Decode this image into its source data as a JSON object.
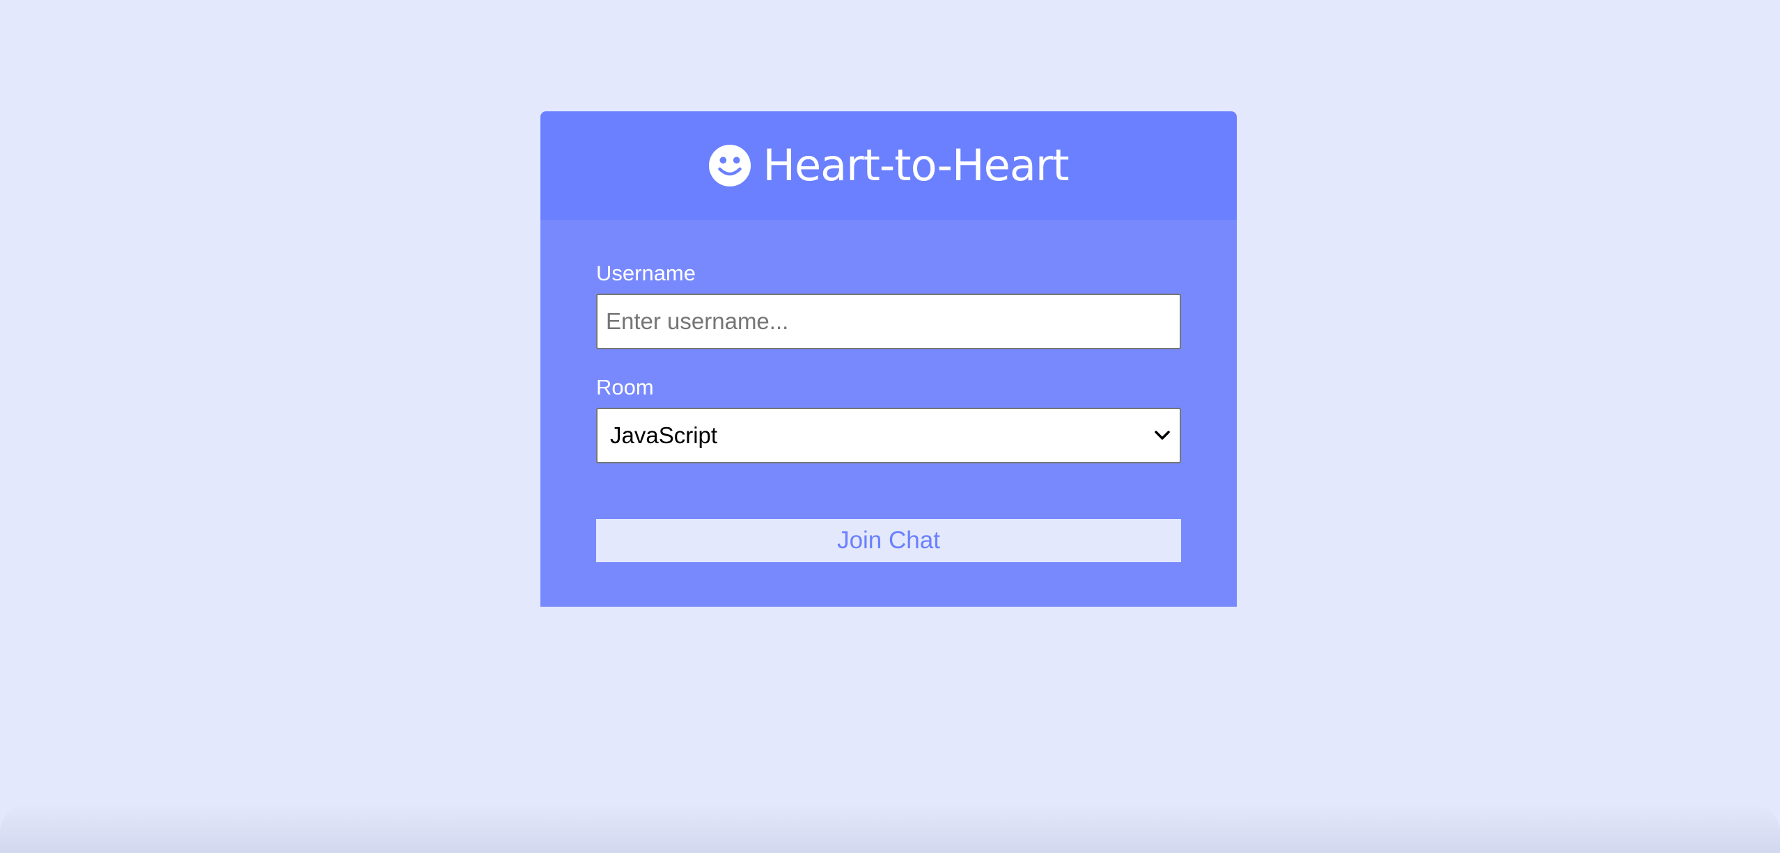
{
  "page": {
    "background_color": "#e3e8fc"
  },
  "header": {
    "icon": "smile-icon",
    "title": "Heart-to-Heart",
    "background_color": "#6b80fe"
  },
  "form": {
    "background_color": "#7789fd",
    "username": {
      "label": "Username",
      "value": "",
      "placeholder": "Enter username..."
    },
    "room": {
      "label": "Room",
      "selected": "JavaScript",
      "icon": "chevron-down-icon"
    },
    "join_button": {
      "label": "Join Chat"
    }
  }
}
